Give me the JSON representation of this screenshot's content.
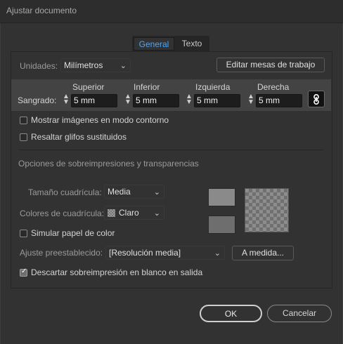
{
  "window": {
    "title": "Ajustar documento"
  },
  "tabs": [
    {
      "label": "General"
    },
    {
      "label": "Texto"
    }
  ],
  "units": {
    "label": "Unidades:",
    "value": "Milímetros"
  },
  "edit_artboards_button": "Editar mesas de trabajo",
  "bleed": {
    "label": "Sangrado:",
    "fields": [
      {
        "label": "Superior",
        "value": "5 mm"
      },
      {
        "label": "Inferior",
        "value": "5 mm"
      },
      {
        "label": "Izquierda",
        "value": "5 mm"
      },
      {
        "label": "Derecha",
        "value": "5 mm"
      }
    ]
  },
  "options": {
    "outline_images": {
      "label": "Mostrar imágenes en modo contorno",
      "checked": false
    },
    "highlight_glyphs": {
      "label": "Resaltar glifos sustituidos",
      "checked": false
    }
  },
  "section_title": "Opciones de sobreimpresiones y transparencias",
  "grid_size": {
    "label": "Tamaño cuadrícula:",
    "value": "Media"
  },
  "grid_colors": {
    "label": "Colores de cuadrícula:",
    "value": "Claro"
  },
  "simulate_paper": {
    "label": "Simular papel de color",
    "checked": false
  },
  "preset": {
    "label": "Ajuste preestablecido:",
    "value": "[Resolución media]",
    "custom_button": "A medida..."
  },
  "discard_overprint": {
    "label": "Descartar sobreimpresión en blanco en salida",
    "checked": true
  },
  "footer": {
    "ok": "OK",
    "cancel": "Cancelar"
  },
  "colors": {
    "active_tab": "#4aa6ff",
    "swatch_top": "#8a8a8a",
    "swatch_bottom": "#6e6e6e"
  }
}
